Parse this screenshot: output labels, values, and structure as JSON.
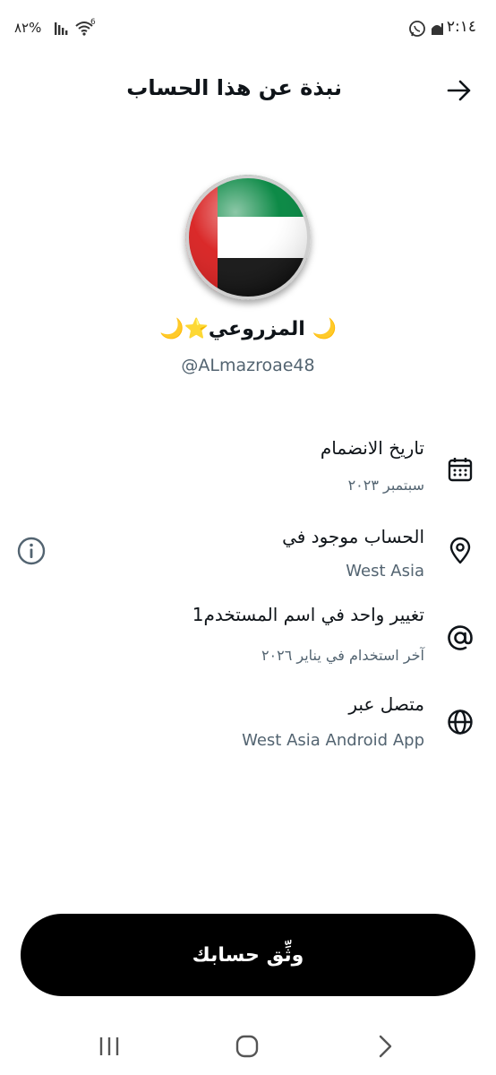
{
  "status_bar": {
    "time": "٢:١٤",
    "battery": "%٨٢",
    "wifi_badge": "6",
    "icons": [
      "whatsapp-icon",
      "mosque-icon",
      "signal-icon",
      "wifi-icon"
    ]
  },
  "header": {
    "title": "نبذة عن هذا الحساب",
    "back_icon": "arrow-right-icon"
  },
  "profile": {
    "display_name": "🌙 المزروعي⭐🌙",
    "handle": "@ALmazroae48"
  },
  "rows": [
    {
      "icon": "calendar-icon",
      "title": "تاريخ الانضمام",
      "subtitle": "سبتمبر ٢٠٢٣"
    },
    {
      "icon": "location-pin-icon",
      "title": "الحساب موجود في",
      "subtitle": "West Asia"
    },
    {
      "icon": "at-sign-icon",
      "title": "تغيير واحد في اسم المستخدم1",
      "subtitle": "آخر استخدام في يناير ٢٠٢٦"
    },
    {
      "icon": "globe-icon",
      "title": "متصل عبر",
      "subtitle": "West Asia Android App"
    }
  ],
  "verify_button": {
    "label": "وثِّق حسابك"
  },
  "colors": {
    "flag_green": "#00843d",
    "flag_red": "#d81e1e",
    "flag_black": "#111111",
    "muted_text": "#536471",
    "button_bg": "#000000"
  },
  "nav_bar": {
    "icons": [
      "recents-icon",
      "home-icon",
      "back-chevron-icon"
    ]
  }
}
